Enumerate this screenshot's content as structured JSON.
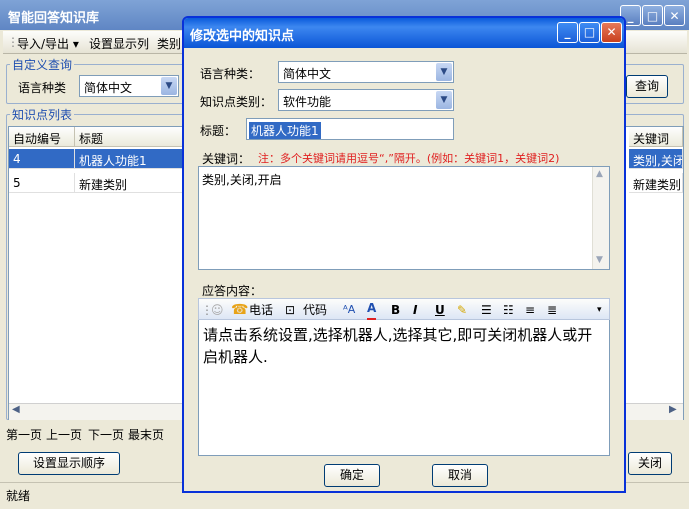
{
  "main": {
    "title": "智能回答知识库",
    "menu": {
      "import_export": "导入/导出 ▾",
      "display_settings": "设置显示列",
      "category": "类别"
    },
    "query_group": {
      "label": "自定义查询",
      "lang_label": "语言种类",
      "lang_value": "简体中文",
      "query_button": "查询"
    },
    "list_group": {
      "label": "知识点列表",
      "columns": [
        "自动编号",
        "标题",
        "关键词"
      ],
      "rows": [
        {
          "id": "4",
          "title": "机器人功能1",
          "keywords": "类别,关闭"
        },
        {
          "id": "5",
          "title": "新建类别",
          "keywords": "新建类别"
        }
      ]
    },
    "pager": {
      "first": "第一页",
      "prev": "上一页",
      "next": "下一页",
      "last": "最末页"
    },
    "order_button": "设置显示顺序",
    "close_button": "关闭",
    "status": "就绪"
  },
  "dialog": {
    "title": "修改选中的知识点",
    "lang_label": "语言种类：",
    "lang_value": "简体中文",
    "category_label": "知识点类别：",
    "category_value": "软件功能",
    "title_label": "标题：",
    "title_value": "机器人功能1",
    "keywords_label": "关键词：",
    "keywords_note": "注：多个关键词请用逗号“,”隔开。(例如：关键词1，关键词2)",
    "keywords_value": "类别,关闭,开启",
    "answer_label": "应答内容：",
    "toolbar": {
      "phone": "电话",
      "code": "代码"
    },
    "answer_value": "请点击系统设置,选择机器人,选择其它,即可关闭机器人或开启机器人.",
    "ok_button": "确定",
    "cancel_button": "取消"
  },
  "colors": {
    "selection": "#316ac5",
    "note": "#e02020",
    "group_label": "#1f4fb0",
    "dialog_title": "#0a5bdb"
  }
}
